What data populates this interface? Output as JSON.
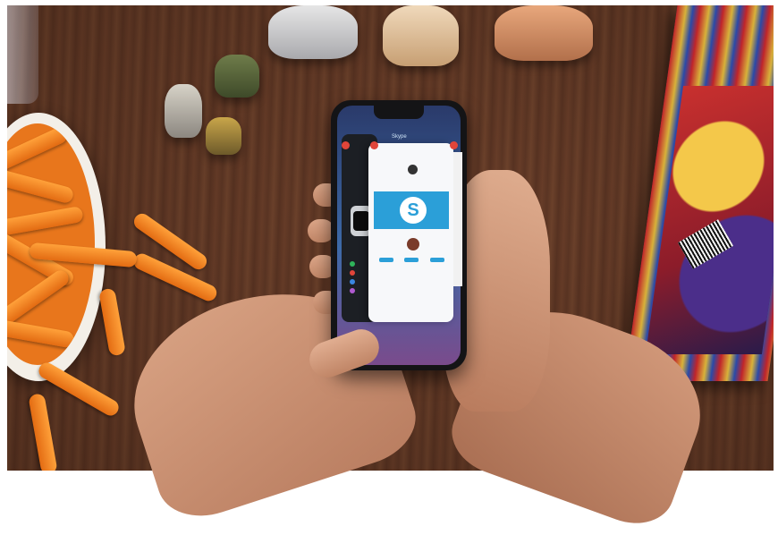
{
  "scene": {
    "description_labels": {
      "skype_app_name": "Skype",
      "skype_logo_glyph": "S"
    }
  },
  "colors": {
    "wood": "#6b3f2a",
    "snack": "#e8761c",
    "skype_blue": "#2b9fd8",
    "phone_body": "#141416"
  },
  "icons": [
    "skype-logo-icon",
    "watch-icon",
    "close-badge-icon"
  ]
}
